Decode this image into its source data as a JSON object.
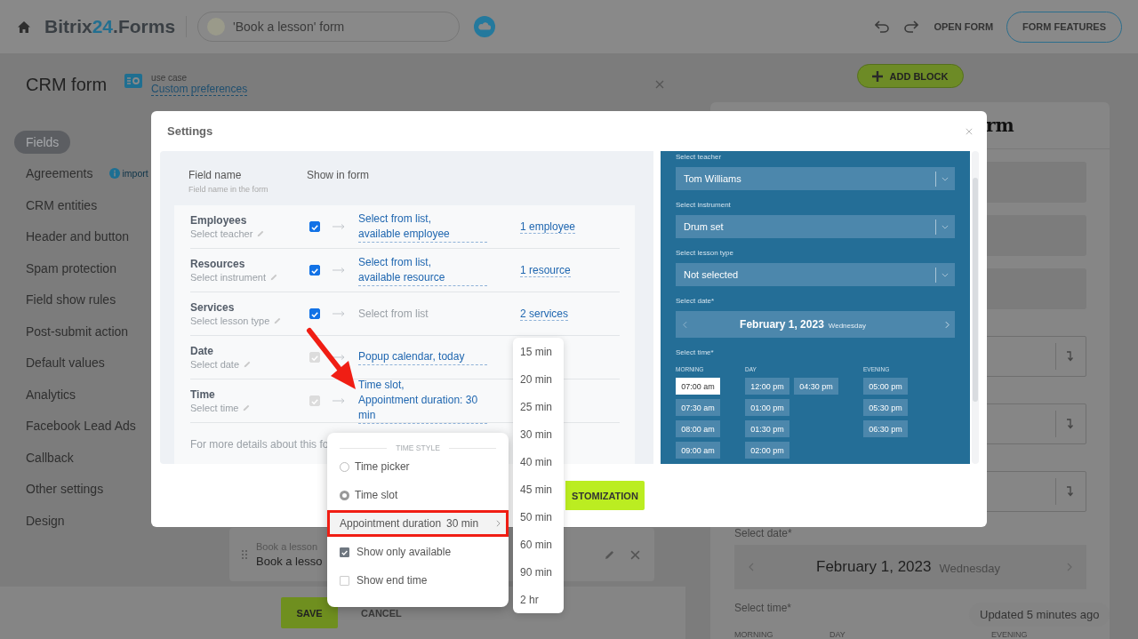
{
  "header": {
    "logo_name": "Bitrix",
    "logo_number": "24",
    "logo_suffix": ".Forms",
    "form_title": "'Book a lesson' form",
    "open_form": "OPEN FORM",
    "form_features": "FORM FEATURES"
  },
  "page": {
    "title": "CRM form",
    "use_case_label": "use case",
    "use_case_value": "Custom preferences"
  },
  "sidebar": {
    "items": [
      {
        "label": "Fields",
        "selected": true
      },
      {
        "label": "Agreements",
        "selected": false,
        "hint": "import"
      },
      {
        "label": "CRM entities",
        "selected": false
      },
      {
        "label": "Header and button",
        "selected": false
      },
      {
        "label": "Spam protection",
        "selected": false
      },
      {
        "label": "Field show rules",
        "selected": false
      },
      {
        "label": "Post-submit action",
        "selected": false
      },
      {
        "label": "Default values",
        "selected": false
      },
      {
        "label": "Analytics",
        "selected": false
      },
      {
        "label": "Facebook Lead Ads",
        "selected": false
      },
      {
        "label": "Callback",
        "selected": false
      },
      {
        "label": "Other settings",
        "selected": false
      },
      {
        "label": "Design",
        "selected": false
      }
    ]
  },
  "block_card": {
    "label": "Book a lesson",
    "value": "Book a lesso"
  },
  "footer": {
    "save": "SAVE",
    "cancel": "CANCEL"
  },
  "form_preview": {
    "add_block": "ADD BLOCK",
    "title": "rm",
    "fields": [
      {
        "kind": "blank"
      },
      {
        "kind": "blank"
      },
      {
        "kind": "blank"
      },
      {
        "kind": "select"
      },
      {
        "kind": "select"
      },
      {
        "kind": "select"
      }
    ],
    "date_label": "Select date*",
    "date": "February 1, 2023",
    "weekday": "Wednesday",
    "time_label": "Select time*",
    "periods": [
      "MORNING",
      "DAY",
      "EVENING"
    ]
  },
  "status": "Updated 5 minutes ago",
  "settings": {
    "title": "Settings",
    "columns": {
      "field_name": "Field name",
      "field_name_hint": "Field name in the form",
      "show_in_form": "Show in form"
    },
    "rows": [
      {
        "name": "Employees",
        "caption": "Select teacher",
        "checked": true,
        "disabled": false,
        "value_lines": [
          "Select from list,",
          "available employee"
        ],
        "kind": "link",
        "count": "1 employee"
      },
      {
        "name": "Resources",
        "caption": "Select instrument",
        "checked": true,
        "disabled": false,
        "value_lines": [
          "Select from list,",
          "available resource"
        ],
        "kind": "link",
        "count": "1 resource"
      },
      {
        "name": "Services",
        "caption": "Select lesson type",
        "checked": true,
        "disabled": false,
        "value_lines": [
          "Select from list"
        ],
        "kind": "plain",
        "count": "2 services"
      },
      {
        "name": "Date",
        "caption": "Select date",
        "checked": true,
        "disabled": true,
        "value_lines": [
          "Popup calendar, today"
        ],
        "kind": "link"
      },
      {
        "name": "Time",
        "caption": "Select time",
        "checked": true,
        "disabled": true,
        "value_lines": [
          "Time slot,",
          "Appointment duration: 30 min"
        ],
        "kind": "link"
      }
    ],
    "note": "For more details about this fo",
    "primary_button": "STOMIZATION",
    "preview": {
      "selects": [
        {
          "label": "Select teacher",
          "value": "Tom Williams"
        },
        {
          "label": "Select instrument",
          "value": "Drum set"
        },
        {
          "label": "Select lesson type",
          "value": "Not selected"
        }
      ],
      "date_label": "Select date*",
      "date": "February 1, 2023",
      "weekday": "Wednesday",
      "time_label": "Select time*",
      "periods": [
        {
          "label": "MORNING",
          "columns": [
            [
              {
                "time": "07:00 am",
                "selected": true
              },
              {
                "time": "07:30 am",
                "selected": false
              },
              {
                "time": "08:00 am",
                "selected": false
              },
              {
                "time": "09:00 am",
                "selected": false
              }
            ]
          ]
        },
        {
          "label": "DAY",
          "columns": [
            [
              {
                "time": "12:00 pm",
                "selected": false
              },
              {
                "time": "01:00 pm",
                "selected": false
              },
              {
                "time": "01:30 pm",
                "selected": false
              },
              {
                "time": "02:00 pm",
                "selected": false
              }
            ],
            [
              {
                "time": "04:30 pm",
                "selected": false
              }
            ]
          ]
        },
        {
          "label": "EVENING",
          "columns": [
            [
              {
                "time": "05:00 pm",
                "selected": false
              },
              {
                "time": "05:30 pm",
                "selected": false
              },
              {
                "time": "06:30 pm",
                "selected": false
              }
            ]
          ]
        }
      ]
    }
  },
  "time_style_menu": {
    "heading": "TIME STYLE",
    "options": [
      {
        "label": "Time picker",
        "selected": false
      },
      {
        "label": "Time slot",
        "selected": true
      }
    ],
    "duration": {
      "label": "Appointment duration",
      "value": "30 min",
      "highlighted": true
    },
    "checks": [
      {
        "label": "Show only available",
        "checked": true
      },
      {
        "label": "Show end time",
        "checked": false
      }
    ]
  },
  "duration_list": {
    "items": [
      "15 min",
      "20 min",
      "25 min",
      "30 min",
      "40 min",
      "45 min",
      "50 min",
      "60 min",
      "90 min",
      "2 hr"
    ]
  },
  "annotation": {
    "kind": "arrow"
  }
}
